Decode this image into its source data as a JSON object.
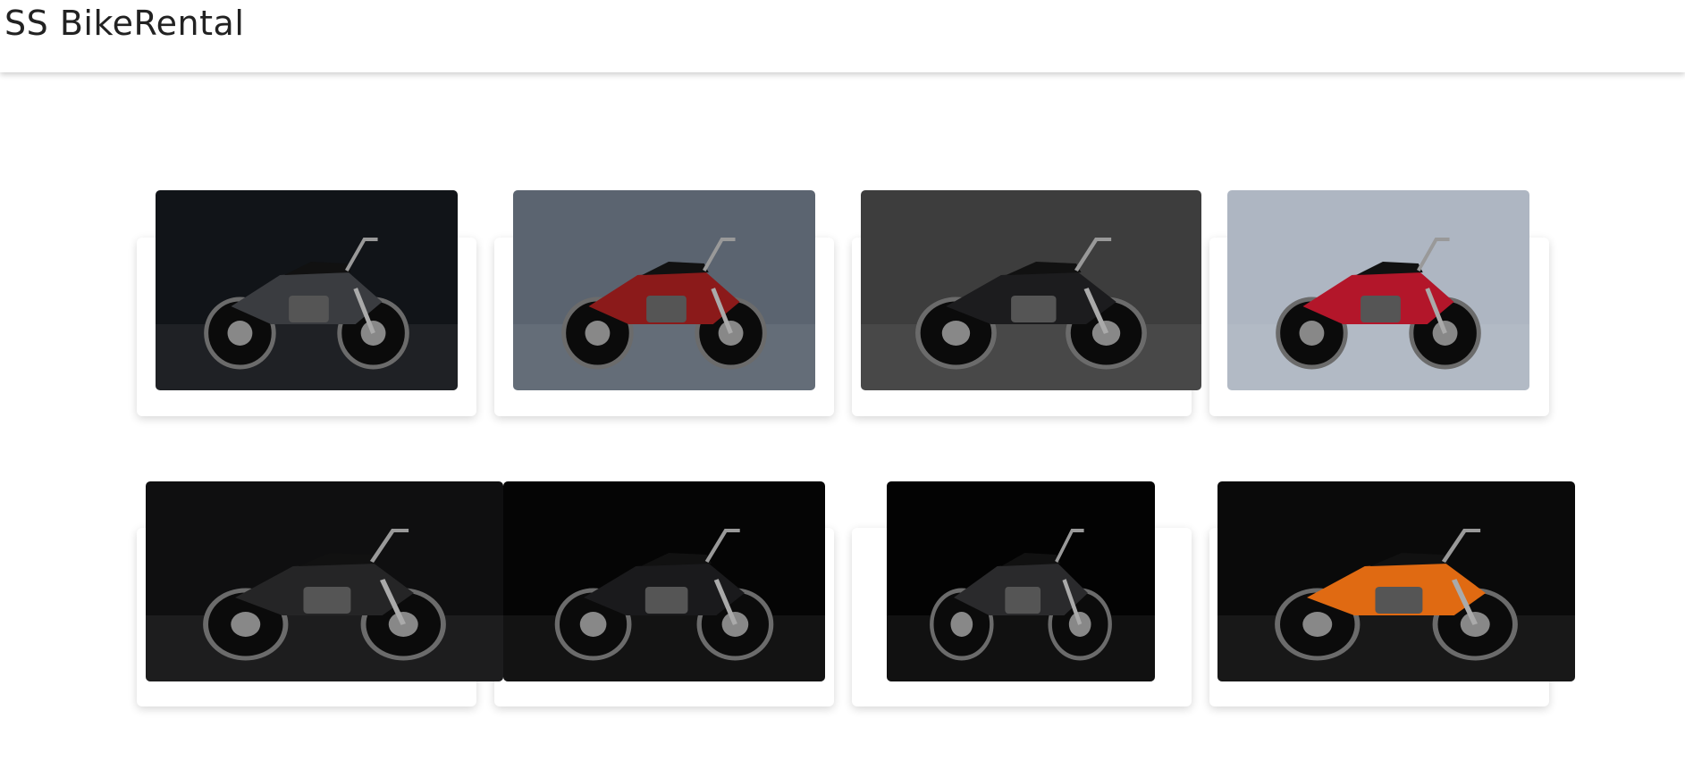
{
  "navbar": {
    "brand": "SS BikeRental"
  },
  "bikes": [
    {
      "name": "bike-photo-1",
      "bg": "#111418",
      "body": "#3a3c40"
    },
    {
      "name": "bike-photo-2",
      "bg": "#5b6470",
      "body": "#8b1a1a"
    },
    {
      "name": "bike-photo-3",
      "bg": "#3d3d3d",
      "body": "#1c1c1e"
    },
    {
      "name": "bike-photo-4",
      "bg": "#aeb6c2",
      "body": "#b3162a"
    },
    {
      "name": "bike-photo-5",
      "bg": "#0f0f10",
      "body": "#252526"
    },
    {
      "name": "bike-photo-6",
      "bg": "#050505",
      "body": "#1a1a1c"
    },
    {
      "name": "bike-photo-7",
      "bg": "#030303",
      "body": "#2a2a2c"
    },
    {
      "name": "bike-photo-8",
      "bg": "#0a0a0a",
      "body": "#e06a12"
    }
  ]
}
